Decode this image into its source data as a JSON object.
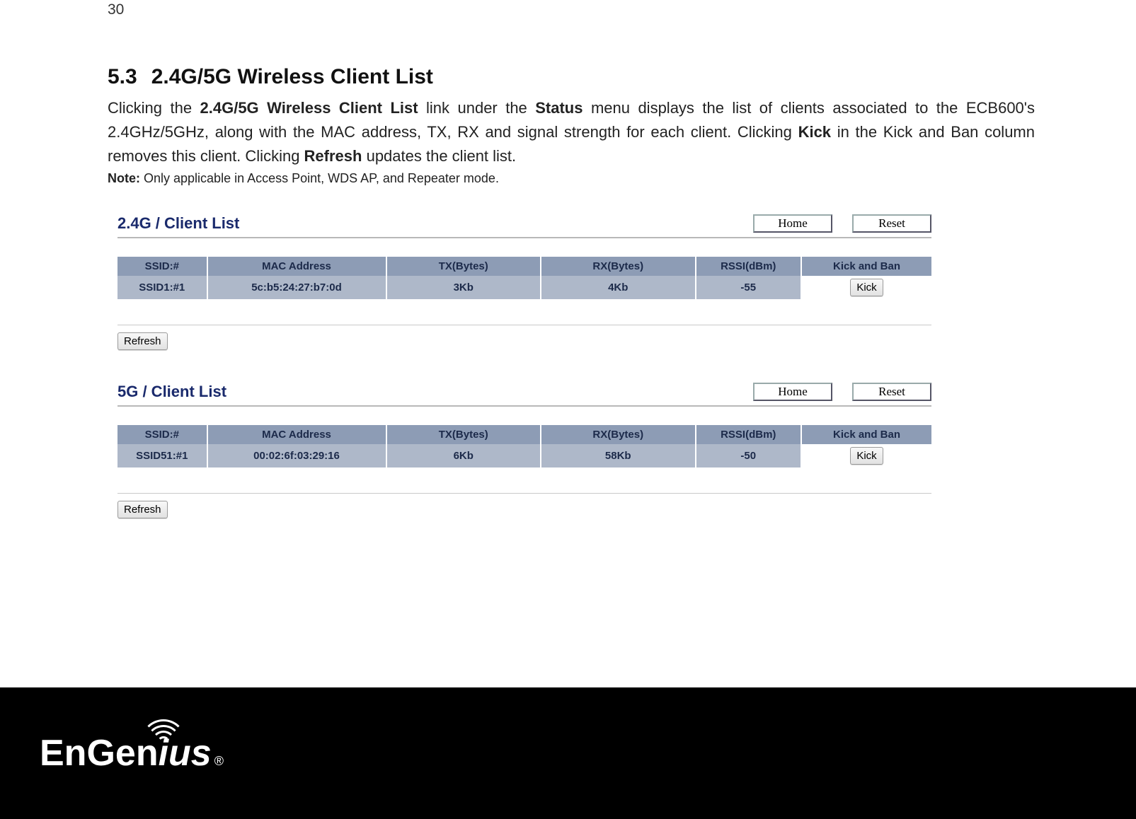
{
  "page_number": "30",
  "section": {
    "number": "5.3",
    "title": "2.4G/5G Wireless Client List"
  },
  "body": {
    "pre1": "Clicking the ",
    "b1": "2.4G/5G Wireless Client List",
    "mid1": " link under the ",
    "b2": "Status",
    "mid2": " menu displays the list of clients associated to the ECB600's 2.4GHz/5GHz, along with the MAC address, TX, RX and signal strength for each client. Clicking ",
    "b3": "Kick",
    "mid3": " in the Kick and Ban column removes this client. Clicking ",
    "b4": "Refresh",
    "post": " updates the client list."
  },
  "note": {
    "label": "Note:",
    "text": " Only applicable in Access Point, WDS AP, and Repeater mode."
  },
  "buttons": {
    "home": "Home",
    "reset": "Reset",
    "refresh": "Refresh",
    "kick": "Kick"
  },
  "columns": {
    "ssid": "SSID:#",
    "mac": "MAC Address",
    "tx": "TX(Bytes)",
    "rx": "RX(Bytes)",
    "rssi": "RSSI(dBm)",
    "kick": "Kick and Ban"
  },
  "panel24": {
    "title": "2.4G / Client List",
    "row": {
      "ssid": "SSID1:#1",
      "mac": "5c:b5:24:27:b7:0d",
      "tx": "3Kb",
      "rx": "4Kb",
      "rssi": "-55"
    }
  },
  "panel5": {
    "title": "5G / Client List",
    "row": {
      "ssid": "SSID51:#1",
      "mac": "00:02:6f:03:29:16",
      "tx": "6Kb",
      "rx": "58Kb",
      "rssi": "-50"
    }
  },
  "logo": {
    "part1": "EnGen",
    "part2_i": "i",
    "part3": "us",
    "reg": "®"
  }
}
